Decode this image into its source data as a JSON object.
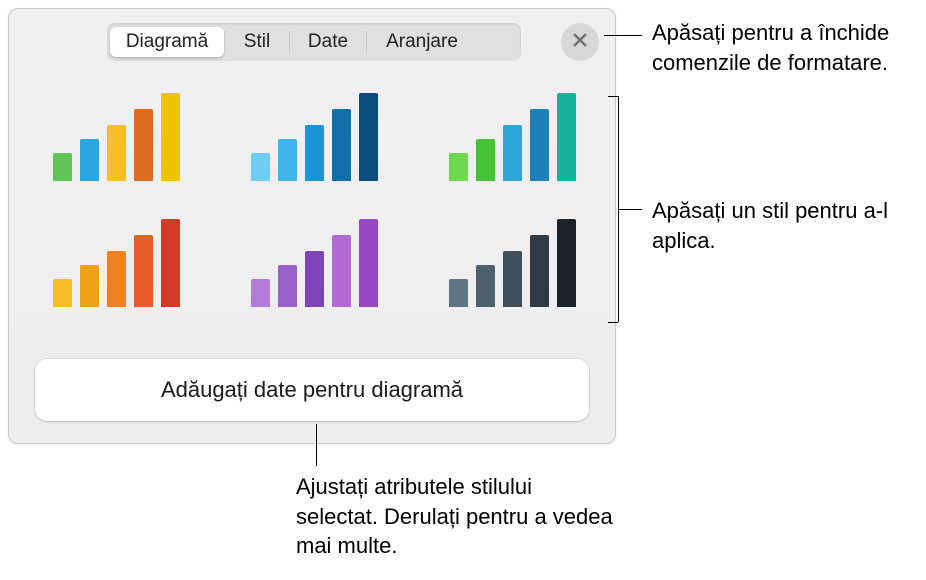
{
  "tabs": [
    "Diagramă",
    "Stil",
    "Date",
    "Aranjare"
  ],
  "activeTab": 0,
  "closeIconName": "close-icon",
  "addDataLabel": "Adăugați date pentru diagramă",
  "styleThumbs": [
    [
      "#61c457",
      "#2aa7e0",
      "#f5bf26",
      "#dd6b20",
      "#f0c300"
    ],
    [
      "#6fcdf4",
      "#3fb4ea",
      "#1795d4",
      "#0f6fa8",
      "#0a4d7e"
    ],
    [
      "#6ed84f",
      "#45c536",
      "#2fa6d8",
      "#1f7fb8",
      "#14b39a"
    ],
    [
      "#f5bf26",
      "#f0a216",
      "#ee8220",
      "#e85c25",
      "#d73826"
    ],
    [
      "#b47bd9",
      "#9a5fc9",
      "#7f44b8",
      "#b268d1",
      "#9647c4"
    ],
    [
      "#5f7584",
      "#4d606e",
      "#3e4f5b",
      "#2e3a44",
      "#1b2228"
    ]
  ],
  "barHeights": [
    28,
    42,
    56,
    72,
    88
  ],
  "callouts": {
    "close": "Apăsați pentru a închide comenzile de formatare.",
    "styles": "Apăsați un stil pentru a-l aplica.",
    "addData": "Ajustați atributele stilului selectat. Derulați pentru a vedea mai multe."
  }
}
